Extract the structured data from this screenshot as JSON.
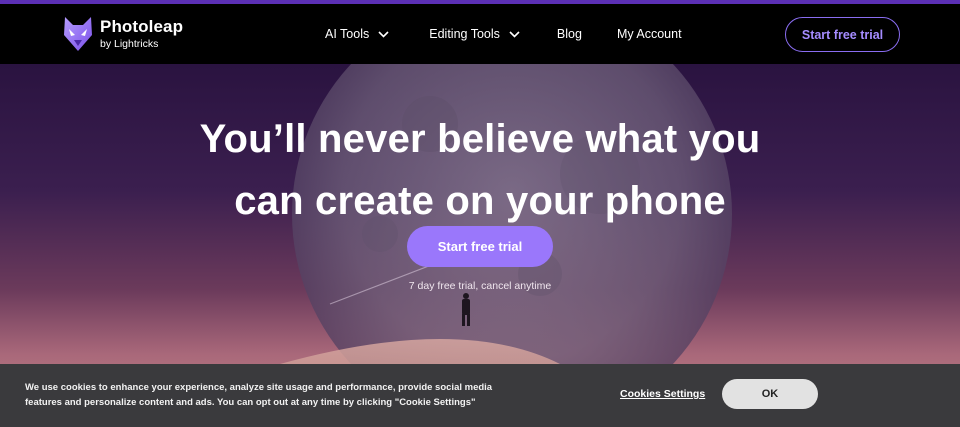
{
  "brand": {
    "name": "Photoleap",
    "sub": "by Lightricks",
    "accent": "#9a77fb"
  },
  "nav": {
    "items": [
      {
        "label": "AI Tools",
        "icon": "chevron-down-icon"
      },
      {
        "label": "Editing Tools",
        "icon": "chevron-down-icon"
      },
      {
        "label": "Blog"
      },
      {
        "label": "My Account"
      }
    ],
    "cta": "Start free trial"
  },
  "hero": {
    "headline_line1": "You’ll never believe what you",
    "headline_line2": "can create on your phone",
    "cta": "Start free trial",
    "note": "7 day free trial, cancel anytime"
  },
  "cookie": {
    "text_line1": "We use cookies to enhance your experience, analyze site usage and performance, provide social media",
    "text_line2": "features and personalize content and ads. You can opt out at any time by clicking \"Cookie Settings\"",
    "settings": "Cookies Settings",
    "ok": "OK"
  }
}
